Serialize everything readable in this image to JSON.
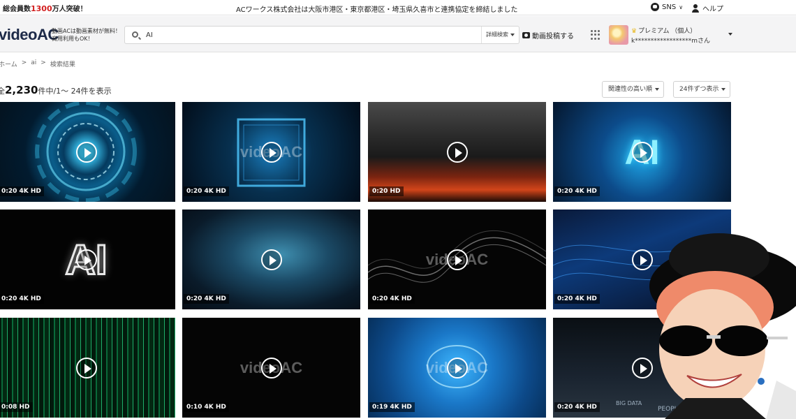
{
  "topbar": {
    "members_prefix": "総会員数",
    "members_num": "1300",
    "members_suffix": "万人突破！",
    "news": "ACワークス株式会社は大阪市港区・東京都港区・埼玉県久喜市と連携協定を締結しました",
    "sns_label": "SNS",
    "help_label": "ヘルプ"
  },
  "header": {
    "logo_a": "video",
    "logo_b": "AC",
    "tagline_1": "動画ACは動画素材が無料！",
    "tagline_2": "商用利用もOK！",
    "search_value": "AI",
    "advanced_search": "詳細検索",
    "upload_label": "動画投稿する",
    "plan_label": "プレミアム （個人）",
    "username": "k******************mさん"
  },
  "breadcrumb": [
    "ホーム",
    ">",
    "ai",
    ">",
    "検索結果"
  ],
  "results": {
    "prefix": "全",
    "count": "2,230",
    "suffix": "件中/1～ 24件を表示",
    "sort_label": "関連性の高い順",
    "per_page_label": "24件ずつ表示"
  },
  "thumbnails": [
    {
      "duration": "0:20 4K HD",
      "theme": "brain-hud"
    },
    {
      "duration": "0:20 4K HD",
      "theme": "brain-chip"
    },
    {
      "duration": "0:20 HD",
      "theme": "smoke-fire"
    },
    {
      "duration": "0:20 4K HD",
      "theme": "ai-letters-blue"
    },
    {
      "duration": "0:20 4K HD",
      "theme": "ai-sparkle"
    },
    {
      "duration": "0:20 4K HD",
      "theme": "globe-network"
    },
    {
      "duration": "0:20 4K HD",
      "theme": "particle-wave"
    },
    {
      "duration": "0:20 4K HD",
      "theme": "blue-mesh"
    },
    {
      "duration": "0:08 HD",
      "theme": "green-matrix"
    },
    {
      "duration": "0:10 4K HD",
      "theme": "black"
    },
    {
      "duration": "0:19 4K HD",
      "theme": "blue-brain"
    },
    {
      "duration": "0:20 4K HD",
      "theme": "tech-words"
    }
  ],
  "text_overlays": {
    "ai_blue": "AI",
    "ai_white": "AI",
    "big_data": "BIG DATA",
    "people": "PEOPLE"
  },
  "watermark": "videoAC"
}
